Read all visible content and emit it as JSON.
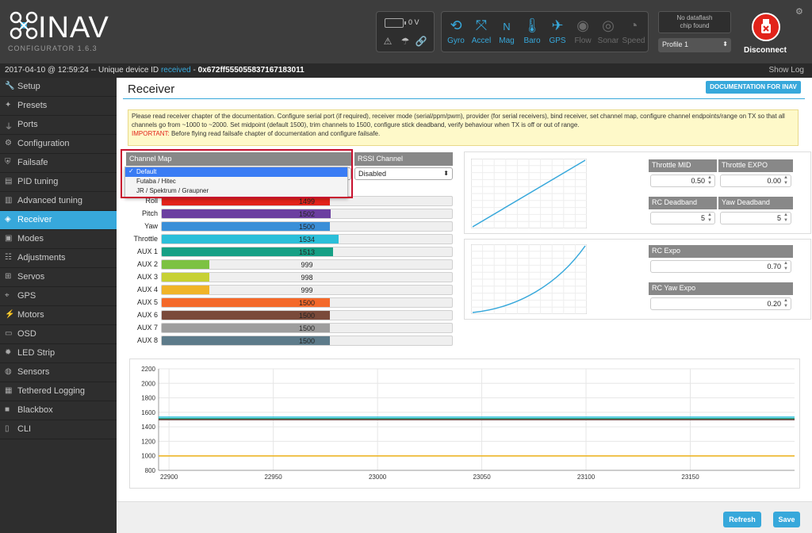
{
  "app": {
    "name": "INAV",
    "subtitle": "CONFIGURATOR  1.6.3"
  },
  "header": {
    "battery_voltage": "0 V",
    "sensors": [
      {
        "label": "Gyro",
        "icon": "gyro-icon",
        "active": true
      },
      {
        "label": "Accel",
        "icon": "accel-icon",
        "active": true
      },
      {
        "label": "Mag",
        "icon": "mag-icon",
        "active": true
      },
      {
        "label": "Baro",
        "icon": "baro-icon",
        "active": true
      },
      {
        "label": "GPS",
        "icon": "gps-icon",
        "active": true
      },
      {
        "label": "Flow",
        "icon": "flow-icon",
        "active": false
      },
      {
        "label": "Sonar",
        "icon": "sonar-icon",
        "active": false
      },
      {
        "label": "Speed",
        "icon": "speed-icon",
        "active": false
      }
    ],
    "dataflash": "No dataflash\nchip found",
    "profile": "Profile 1",
    "disconnect_label": "Disconnect",
    "mag_letter": "N"
  },
  "status": {
    "prefix": "2017-04-10 @ 12:59:24 -- Unique device ID ",
    "received": "received",
    "sep": " - ",
    "uid": "0x672ff555055837167183011",
    "show_log": "Show Log"
  },
  "sidebar": {
    "items": [
      {
        "label": "Setup",
        "icon": "wrench-icon",
        "active": false
      },
      {
        "label": "Presets",
        "icon": "wand-icon",
        "active": false
      },
      {
        "label": "Ports",
        "icon": "plug-icon",
        "active": false
      },
      {
        "label": "Configuration",
        "icon": "gear-icon",
        "active": false
      },
      {
        "label": "Failsafe",
        "icon": "shield-icon",
        "active": false
      },
      {
        "label": "PID tuning",
        "icon": "pid-icon",
        "active": false
      },
      {
        "label": "Advanced tuning",
        "icon": "tuning-icon",
        "active": false
      },
      {
        "label": "Receiver",
        "icon": "receiver-icon",
        "active": true
      },
      {
        "label": "Modes",
        "icon": "modes-icon",
        "active": false
      },
      {
        "label": "Adjustments",
        "icon": "sliders-icon",
        "active": false
      },
      {
        "label": "Servos",
        "icon": "servo-icon",
        "active": false
      },
      {
        "label": "GPS",
        "icon": "gps-icon",
        "active": false
      },
      {
        "label": "Motors",
        "icon": "motor-icon",
        "active": false
      },
      {
        "label": "OSD",
        "icon": "osd-icon",
        "active": false
      },
      {
        "label": "LED Strip",
        "icon": "led-icon",
        "active": false
      },
      {
        "label": "Sensors",
        "icon": "sensors-icon",
        "active": false
      },
      {
        "label": "Tethered Logging",
        "icon": "log-icon",
        "active": false
      },
      {
        "label": "Blackbox",
        "icon": "blackbox-icon",
        "active": false
      },
      {
        "label": "CLI",
        "icon": "cli-icon",
        "active": false
      }
    ]
  },
  "page": {
    "title": "Receiver",
    "doc_button": "DOCUMENTATION FOR INAV",
    "note": "Please read receiver chapter of the documentation. Configure serial port (if required), receiver mode (serial/ppm/pwm), provider (for serial receivers), bind receiver, set channel map, configure channel endpoints/range on TX so that all channels go from ~1000 to ~2000. Set midpoint (default 1500), trim channels to 1500, configure stick deadband, verify behaviour when TX is off or out of range.",
    "note_important_label": "IMPORTANT:",
    "note_important": " Before flying read failsafe chapter of documentation and configure failsafe."
  },
  "channel_map": {
    "header": "Channel Map",
    "selected": "Default",
    "options": [
      "Default",
      "Futaba / Hitec",
      "JR / Spektrum / Graupner"
    ]
  },
  "rssi": {
    "header": "RSSI Channel",
    "value": "Disabled"
  },
  "channels": [
    {
      "name": "Roll",
      "value": 1499,
      "color": "#e2231a"
    },
    {
      "name": "Pitch",
      "value": 1502,
      "color": "#6b3fa0"
    },
    {
      "name": "Yaw",
      "value": 1500,
      "color": "#3a8fd8"
    },
    {
      "name": "Throttle",
      "value": 1534,
      "color": "#2bbfd9"
    },
    {
      "name": "AUX 1",
      "value": 1513,
      "color": "#16a085"
    },
    {
      "name": "AUX 2",
      "value": 999,
      "color": "#7cc242"
    },
    {
      "name": "AUX 3",
      "value": 998,
      "color": "#c7d134"
    },
    {
      "name": "AUX 4",
      "value": 999,
      "color": "#f0b429"
    },
    {
      "name": "AUX 5",
      "value": 1500,
      "color": "#f4692a"
    },
    {
      "name": "AUX 6",
      "value": 1500,
      "color": "#7a4a3a"
    },
    {
      "name": "AUX 7",
      "value": 1500,
      "color": "#9e9e9e"
    },
    {
      "name": "AUX 8",
      "value": 1500,
      "color": "#5d7b8a"
    }
  ],
  "channel_range": [
    800,
    2200
  ],
  "tuning": {
    "throttle_mid_label": "Throttle MID",
    "throttle_mid": "0.50",
    "throttle_expo_label": "Throttle EXPO",
    "throttle_expo": "0.00",
    "rc_deadband_label": "RC Deadband",
    "rc_deadband": "5",
    "yaw_deadband_label": "Yaw Deadband",
    "yaw_deadband": "5",
    "rc_expo_label": "RC Expo",
    "rc_expo": "0.70",
    "rc_yaw_expo_label": "RC Yaw Expo",
    "rc_yaw_expo": "0.20"
  },
  "chart_data": {
    "type": "line",
    "x": [
      22900,
      22950,
      23000,
      23050,
      23100,
      23150
    ],
    "xlim": [
      22895,
      23200
    ],
    "ylim": [
      800,
      2200
    ],
    "yticks": [
      800,
      1000,
      1200,
      1400,
      1600,
      1800,
      2000,
      2200
    ],
    "xticks": [
      22900,
      22950,
      23000,
      23050,
      23100,
      23150
    ],
    "series": [
      {
        "color": "#e2231a",
        "values": [
          1499,
          1499,
          1499,
          1499,
          1499,
          1499
        ]
      },
      {
        "color": "#6b3fa0",
        "values": [
          1502,
          1502,
          1502,
          1502,
          1502,
          1502
        ]
      },
      {
        "color": "#3a8fd8",
        "values": [
          1500,
          1500,
          1500,
          1500,
          1500,
          1500
        ]
      },
      {
        "color": "#2bbfd9",
        "values": [
          1534,
          1534,
          1534,
          1534,
          1534,
          1534
        ]
      },
      {
        "color": "#16a085",
        "values": [
          1513,
          1513,
          1513,
          1513,
          1513,
          1513
        ]
      },
      {
        "color": "#7cc242",
        "values": [
          999,
          999,
          999,
          999,
          999,
          999
        ]
      },
      {
        "color": "#c7d134",
        "values": [
          998,
          998,
          998,
          998,
          998,
          998
        ]
      },
      {
        "color": "#f0b429",
        "values": [
          999,
          999,
          999,
          999,
          999,
          999
        ]
      },
      {
        "color": "#7a4a3a",
        "values": [
          1500,
          1500,
          1500,
          1500,
          1500,
          1500
        ]
      }
    ],
    "grid": true
  },
  "buttons": {
    "refresh": "Refresh",
    "save": "Save"
  }
}
